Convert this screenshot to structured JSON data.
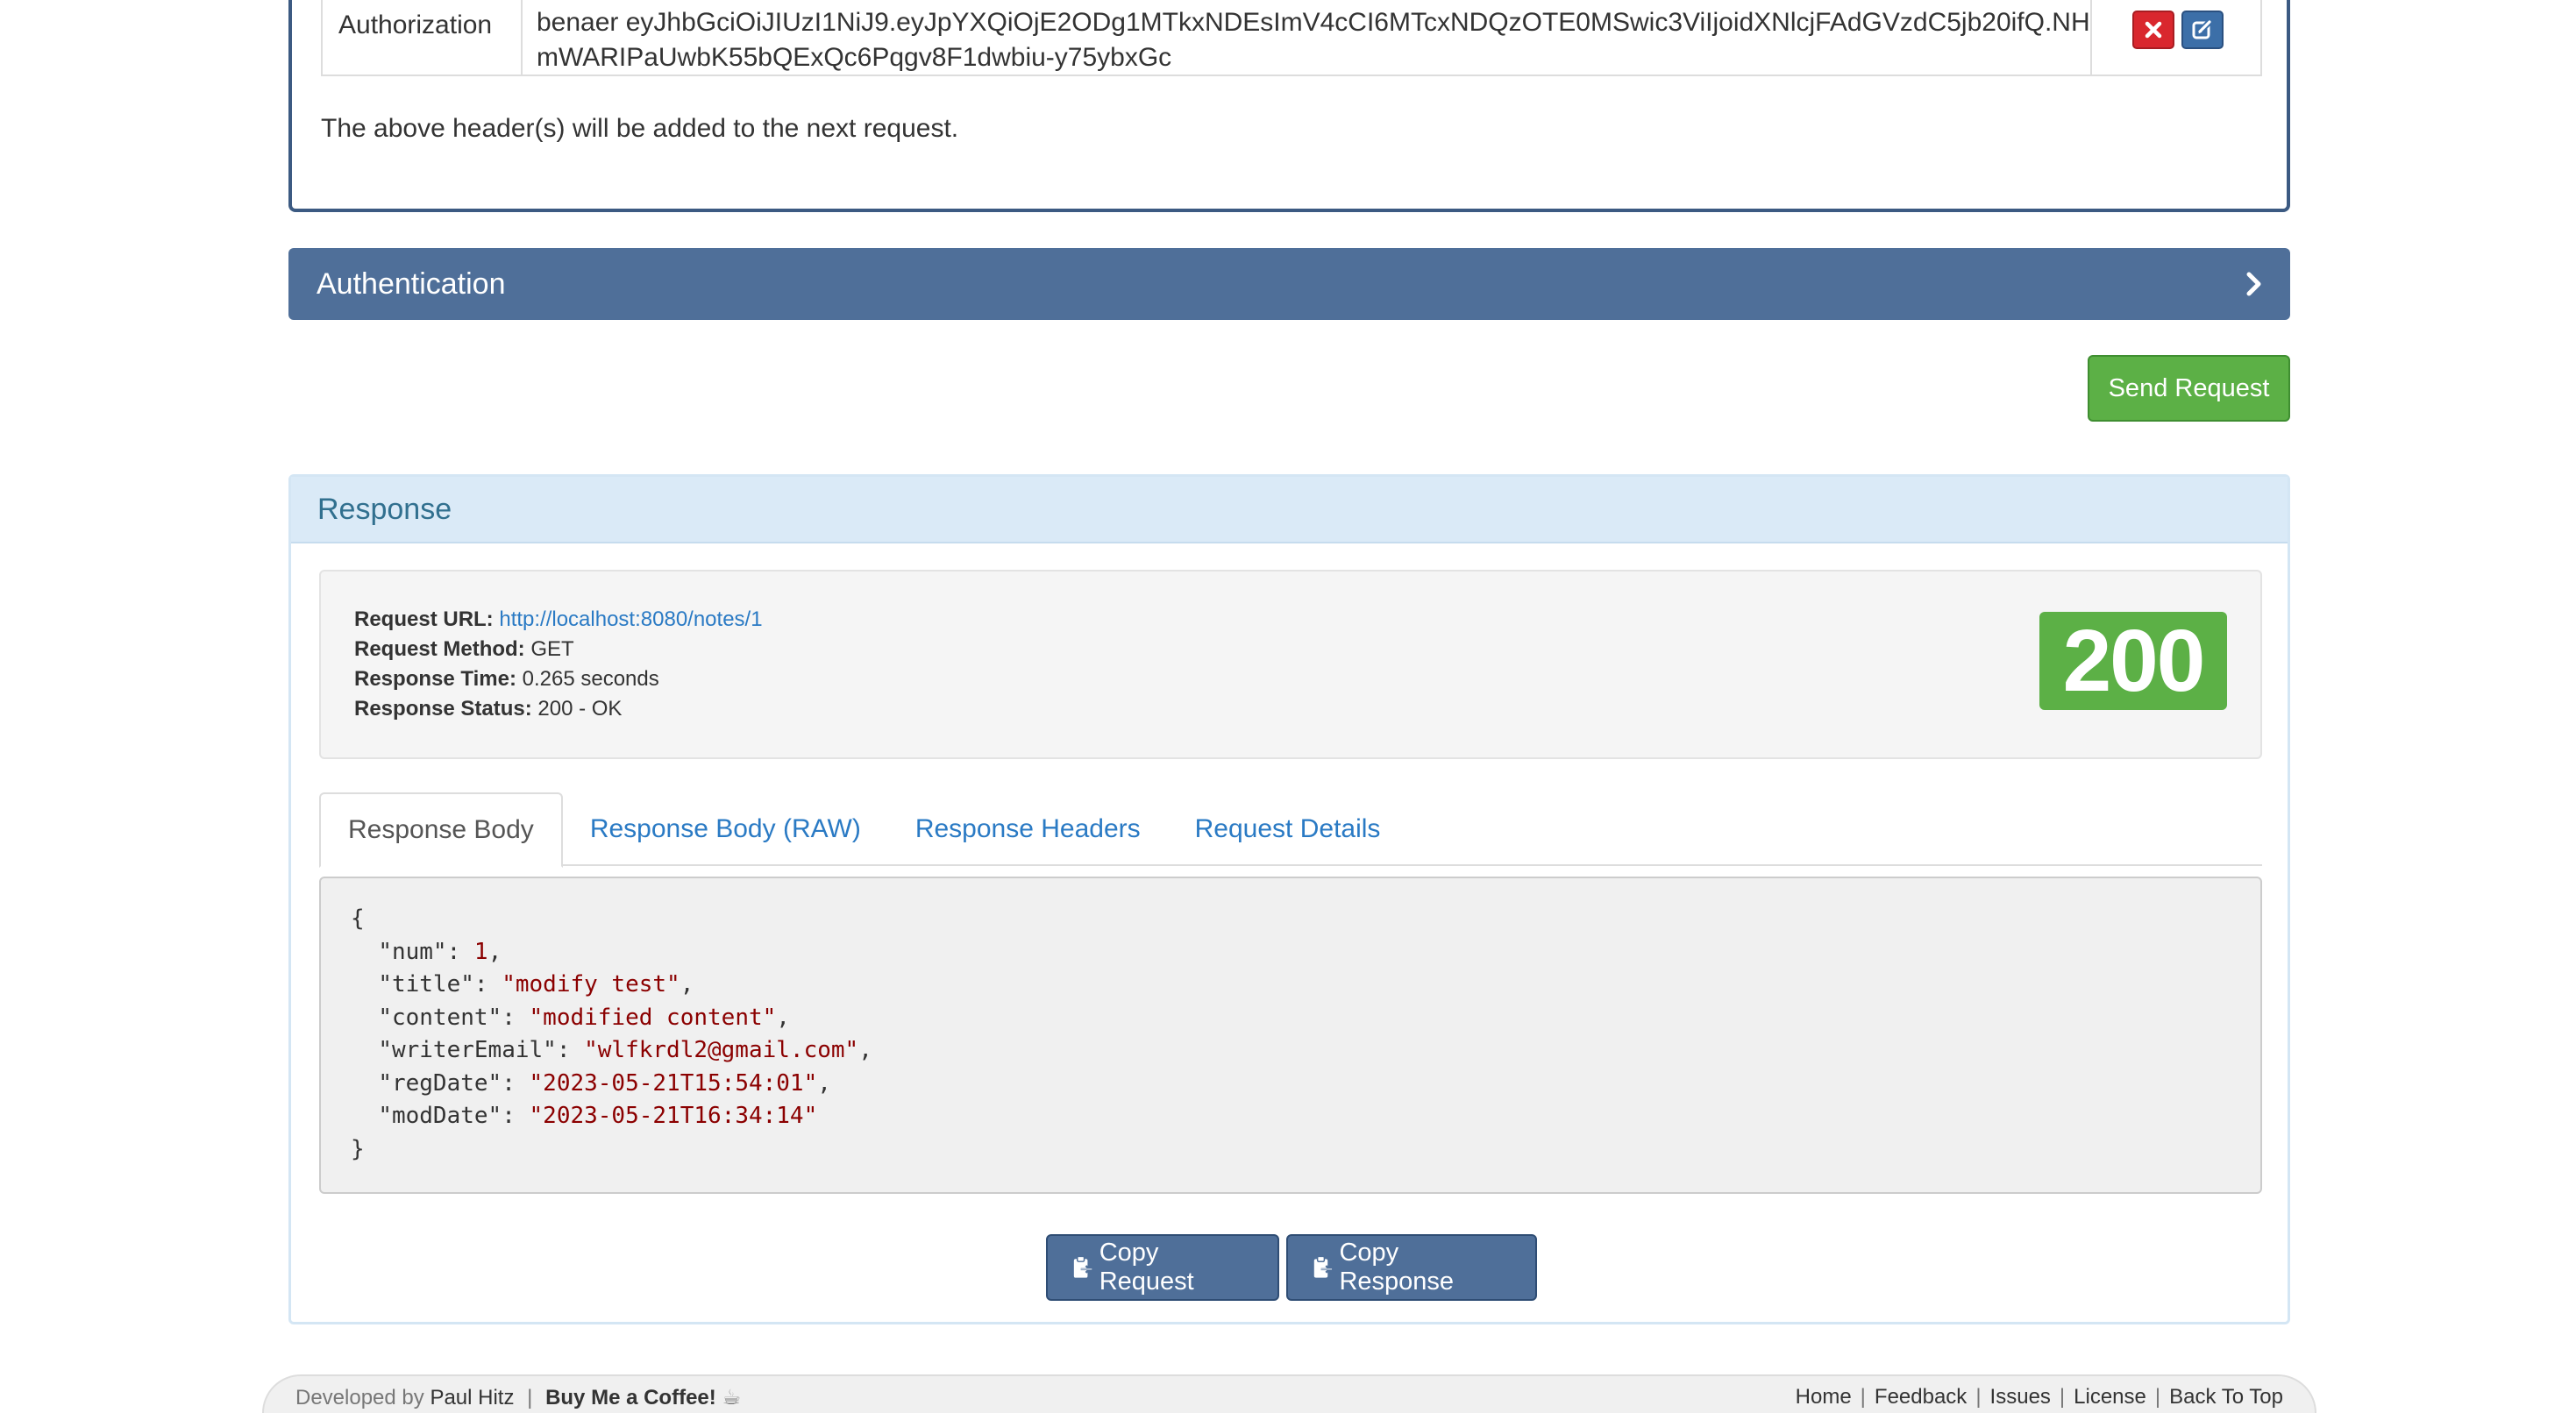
{
  "headers": {
    "rows": [
      {
        "key": "Authorization",
        "value": "benaer eyJhbGciOiJIUzI1NiJ9.eyJpYXQiOjE2ODg1MTkxNDEsImV4cCI6MTcxNDQzOTE0MSwic3ViIjoidXNlcjFAdGVzdC5jb20ifQ.NHmWARIPaUwbK55bQExQc6Pqgv8F1dwbiu-y75ybxGc"
      }
    ],
    "note": "The above header(s) will be added to the next request.",
    "delete_icon": "x-icon",
    "edit_icon": "edit-icon"
  },
  "authentication": {
    "title": "Authentication",
    "icon": "chevron-right-icon"
  },
  "send_button": "Send Request",
  "response": {
    "heading": "Response",
    "summary": {
      "url_label": "Request URL:",
      "url": "http://localhost:8080/notes/1",
      "method_label": "Request Method:",
      "method": "GET",
      "time_label": "Response Time:",
      "time": "0.265 seconds",
      "status_label": "Response Status:",
      "status": "200 - OK"
    },
    "status_code": "200",
    "tabs": [
      {
        "label": "Response Body",
        "active": true
      },
      {
        "label": "Response Body (RAW)",
        "active": false
      },
      {
        "label": "Response Headers",
        "active": false
      },
      {
        "label": "Request Details",
        "active": false
      }
    ],
    "body": {
      "open": "{",
      "close": "}",
      "fields": [
        {
          "key": "\"num\"",
          "value": "1",
          "type": "number",
          "comma": ","
        },
        {
          "key": "\"title\"",
          "value": "\"modify test\"",
          "type": "string",
          "comma": ","
        },
        {
          "key": "\"content\"",
          "value": "\"modified content\"",
          "type": "string",
          "comma": ","
        },
        {
          "key": "\"writerEmail\"",
          "value": "\"wlfkrdl2@gmail.com\"",
          "type": "string",
          "comma": ","
        },
        {
          "key": "\"regDate\"",
          "value": "\"2023-05-21T15:54:01\"",
          "type": "string",
          "comma": ","
        },
        {
          "key": "\"modDate\"",
          "value": "\"2023-05-21T16:34:14\"",
          "type": "string",
          "comma": ""
        }
      ]
    },
    "copy_request": "Copy Request",
    "copy_response": "Copy Response",
    "copy_icon": "clipboard-icon"
  },
  "footer": {
    "developed_by": "Developed by",
    "author": "Paul Hitz",
    "separator": "|",
    "coffee": "Buy Me a Coffee!",
    "coffee_icon": "coffee-icon",
    "links": [
      "Home",
      "Feedback",
      "Issues",
      "License",
      "Back To Top"
    ]
  },
  "colors": {
    "primary": "#4f6f99",
    "success": "#5cb046",
    "danger": "#d9272e",
    "link": "#2a7ac4",
    "response_heading_bg": "#daeaf7"
  }
}
